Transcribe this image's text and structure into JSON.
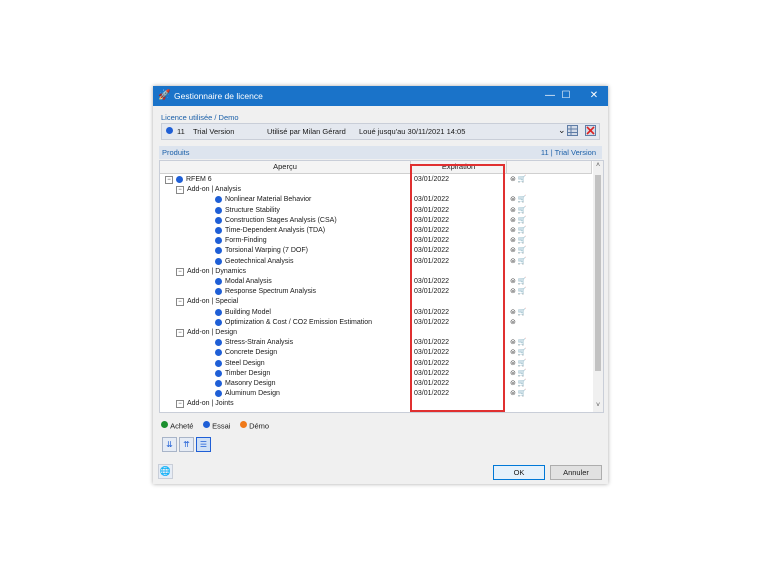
{
  "window": {
    "title": "Gestionnaire de licence",
    "minimize": "—",
    "maximize": "☐",
    "close": "✕"
  },
  "licence": {
    "section_label": "Licence utilisée / Demo",
    "number": "11",
    "type": "Trial Version",
    "used_by": "Utilisé par Milan Gérard",
    "rented_until": "Loué jusqu'au 30/11/2021 14:05"
  },
  "products": {
    "label": "Produits",
    "count": "11 | Trial Version"
  },
  "columns": {
    "apercu": "Aperçu",
    "expiration": "Expiration"
  },
  "rows": [
    {
      "label": "RFEM 6",
      "expiration": "03/01/2022",
      "level": 0,
      "kind": "product",
      "icons": "⊜ 🛒"
    },
    {
      "label": "Add-on | Analysis",
      "expiration": "",
      "level": 1,
      "kind": "group",
      "icons": ""
    },
    {
      "label": "Nonlinear Material Behavior",
      "expiration": "03/01/2022",
      "level": 2,
      "kind": "item",
      "icons": "⊜ 🛒"
    },
    {
      "label": "Structure Stability",
      "expiration": "03/01/2022",
      "level": 2,
      "kind": "item",
      "icons": "⊜ 🛒"
    },
    {
      "label": "Construction Stages Analysis (CSA)",
      "expiration": "03/01/2022",
      "level": 2,
      "kind": "item",
      "icons": "⊜ 🛒"
    },
    {
      "label": "Time-Dependent Analysis (TDA)",
      "expiration": "03/01/2022",
      "level": 2,
      "kind": "item",
      "icons": "⊜ 🛒"
    },
    {
      "label": "Form-Finding",
      "expiration": "03/01/2022",
      "level": 2,
      "kind": "item",
      "icons": "⊜ 🛒"
    },
    {
      "label": "Torsional Warping (7 DOF)",
      "expiration": "03/01/2022",
      "level": 2,
      "kind": "item",
      "icons": "⊜ 🛒"
    },
    {
      "label": "Geotechnical Analysis",
      "expiration": "03/01/2022",
      "level": 2,
      "kind": "item",
      "icons": "⊜ 🛒"
    },
    {
      "label": "Add-on | Dynamics",
      "expiration": "",
      "level": 1,
      "kind": "group",
      "icons": ""
    },
    {
      "label": "Modal Analysis",
      "expiration": "03/01/2022",
      "level": 2,
      "kind": "item",
      "icons": "⊜ 🛒"
    },
    {
      "label": "Response Spectrum Analysis",
      "expiration": "03/01/2022",
      "level": 2,
      "kind": "item",
      "icons": "⊜ 🛒"
    },
    {
      "label": "Add-on | Special",
      "expiration": "",
      "level": 1,
      "kind": "group",
      "icons": ""
    },
    {
      "label": "Building Model",
      "expiration": "03/01/2022",
      "level": 2,
      "kind": "item",
      "icons": "⊜ 🛒"
    },
    {
      "label": "Optimization & Cost / CO2 Emission Estimation",
      "expiration": "03/01/2022",
      "level": 2,
      "kind": "item",
      "icons": "⊜"
    },
    {
      "label": "Add-on | Design",
      "expiration": "",
      "level": 1,
      "kind": "group",
      "icons": ""
    },
    {
      "label": "Stress-Strain Analysis",
      "expiration": "03/01/2022",
      "level": 2,
      "kind": "item",
      "icons": "⊜ 🛒"
    },
    {
      "label": "Concrete Design",
      "expiration": "03/01/2022",
      "level": 2,
      "kind": "item",
      "icons": "⊜ 🛒"
    },
    {
      "label": "Steel Design",
      "expiration": "03/01/2022",
      "level": 2,
      "kind": "item",
      "icons": "⊜ 🛒"
    },
    {
      "label": "Timber Design",
      "expiration": "03/01/2022",
      "level": 2,
      "kind": "item",
      "icons": "⊜ 🛒"
    },
    {
      "label": "Masonry Design",
      "expiration": "03/01/2022",
      "level": 2,
      "kind": "item",
      "icons": "⊜ 🛒"
    },
    {
      "label": "Aluminum Design",
      "expiration": "03/01/2022",
      "level": 2,
      "kind": "item",
      "icons": "⊜ 🛒"
    },
    {
      "label": "Add-on | Joints",
      "expiration": "",
      "level": 1,
      "kind": "group",
      "icons": ""
    }
  ],
  "legend": {
    "purchased": "Acheté",
    "trial": "Essai",
    "demo": "Démo"
  },
  "buttons": {
    "ok": "OK",
    "cancel": "Annuler"
  },
  "colors": {
    "titlebar": "#1a73c9",
    "trial_dot": "#1f5fd6",
    "purchased_dot": "#1a8f2e",
    "demo_dot": "#f07a1a",
    "highlight": "#e03030"
  }
}
